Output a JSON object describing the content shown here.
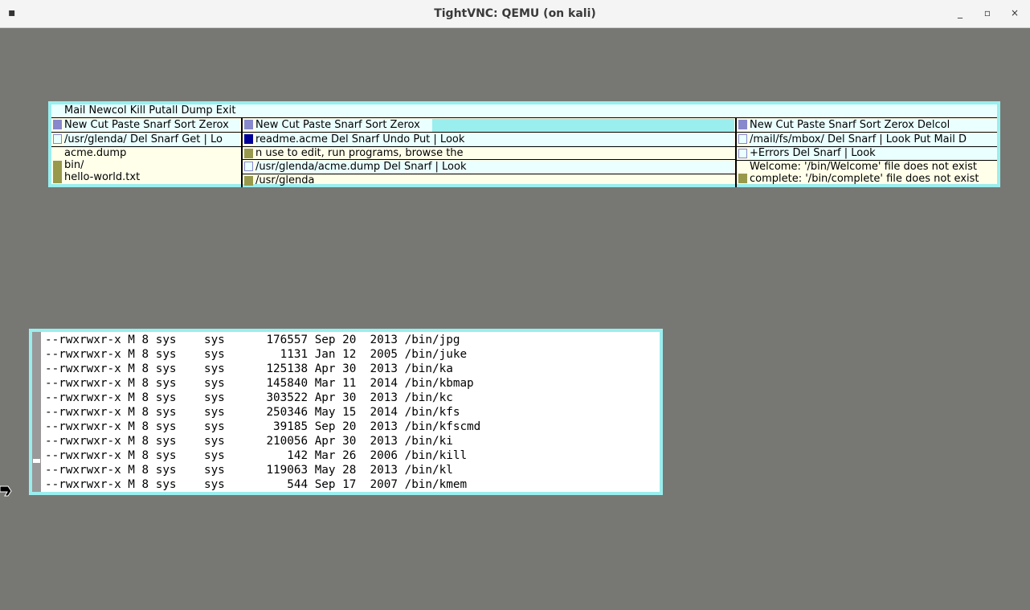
{
  "window": {
    "title": "TightVNC: QEMU (on kali)",
    "menu_glyph": "▪",
    "minimize_glyph": "_",
    "maximize_glyph": "▫",
    "close_glyph": "×"
  },
  "acme": {
    "main_tag": "Mail Newcol Kill Putall Dump Exit",
    "columns": [
      {
        "tag": "New Cut Paste Snarf Sort Zerox",
        "windows": [
          {
            "tag": "/usr/glenda/ Del Snarf Get | Lo",
            "body": [
              "acme.dump",
              "bin/",
              "hello-world.txt"
            ]
          }
        ]
      },
      {
        "tag": "New Cut Paste Snarf Sort Zerox",
        "windows": [
          {
            "tag": "readme.acme Del Snarf Undo Put | Look",
            "body": [
              "n use to edit, run programs, browse the"
            ]
          },
          {
            "tag": "/usr/glenda/acme.dump Del Snarf | Look",
            "body": [
              "/usr/glenda"
            ]
          }
        ]
      },
      {
        "tag": "New Cut Paste Snarf Sort Zerox Delcol",
        "windows": [
          {
            "tag": "/mail/fs/mbox/ Del Snarf | Look Put Mail D",
            "body": []
          },
          {
            "tag": "+Errors Del Snarf | Look",
            "body": [
              "Welcome: '/bin/Welcome' file does not exist",
              "complete: '/bin/complete' file does not exist"
            ]
          }
        ]
      }
    ]
  },
  "terminal": {
    "lines": [
      "--rwxrwxr-x M 8 sys    sys      176557 Sep 20  2013 /bin/jpg",
      "--rwxrwxr-x M 8 sys    sys        1131 Jan 12  2005 /bin/juke",
      "--rwxrwxr-x M 8 sys    sys      125138 Apr 30  2013 /bin/ka",
      "--rwxrwxr-x M 8 sys    sys      145840 Mar 11  2014 /bin/kbmap",
      "--rwxrwxr-x M 8 sys    sys      303522 Apr 30  2013 /bin/kc",
      "--rwxrwxr-x M 8 sys    sys      250346 May 15  2014 /bin/kfs",
      "--rwxrwxr-x M 8 sys    sys       39185 Sep 20  2013 /bin/kfscmd",
      "--rwxrwxr-x M 8 sys    sys      210056 Apr 30  2013 /bin/ki",
      "--rwxrwxr-x M 8 sys    sys         142 Mar 26  2006 /bin/kill",
      "--rwxrwxr-x M 8 sys    sys      119063 May 28  2013 /bin/kl",
      "--rwxrwxr-x M 8 sys    sys         544 Sep 17  2007 /bin/kmem"
    ]
  }
}
